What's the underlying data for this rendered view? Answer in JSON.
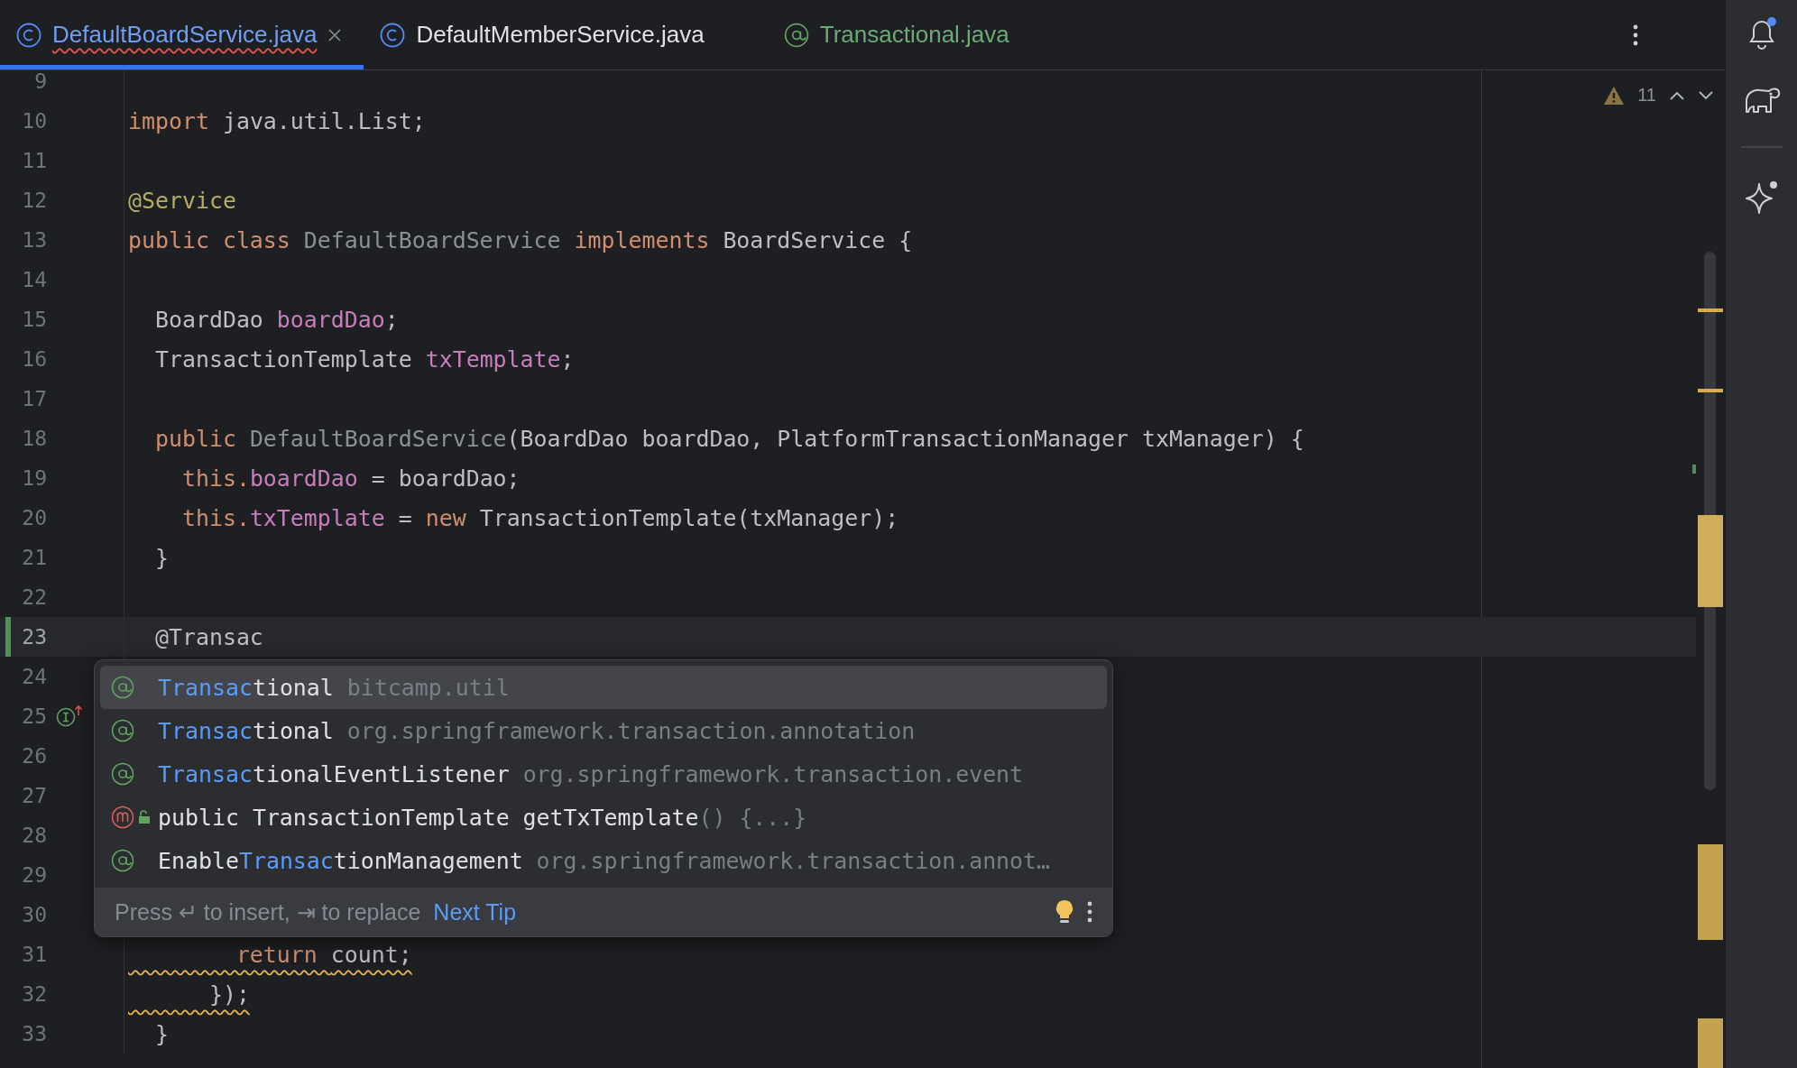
{
  "tabs": [
    {
      "kind": "class",
      "label": "DefaultBoardService.java",
      "color": "#6f9ff5",
      "has_error": true,
      "selected": true
    },
    {
      "kind": "class",
      "label": "DefaultMemberService.java",
      "color": "#dfe1e5",
      "has_error": false,
      "selected": false
    },
    {
      "kind": "annotation",
      "label": "Transactional.java",
      "color": "#6aab73",
      "has_error": false,
      "selected": false
    }
  ],
  "inspections": {
    "warning_count": "11"
  },
  "lines": [
    {
      "number": "9"
    },
    {
      "number": "10",
      "tokens": [
        {
          "text": "import ",
          "kind": "keyword"
        },
        {
          "text": "java.util.List;",
          "kind": "plain"
        }
      ]
    },
    {
      "number": "11"
    },
    {
      "number": "12",
      "tokens": [
        {
          "text": "@Service",
          "kind": "annotation"
        }
      ]
    },
    {
      "number": "13",
      "tokens": [
        {
          "text": "public class ",
          "kind": "keyword"
        },
        {
          "text": "DefaultBoardService ",
          "kind": "unused"
        },
        {
          "text": "implements ",
          "kind": "keyword"
        },
        {
          "text": "BoardService {",
          "kind": "plain"
        }
      ]
    },
    {
      "number": "14"
    },
    {
      "number": "15",
      "tokens": [
        {
          "text": "  BoardDao ",
          "kind": "plain"
        },
        {
          "text": "boardDao",
          "kind": "field"
        },
        {
          "text": ";",
          "kind": "plain"
        }
      ]
    },
    {
      "number": "16",
      "tokens": [
        {
          "text": "  TransactionTemplate ",
          "kind": "plain"
        },
        {
          "text": "txTemplate",
          "kind": "field"
        },
        {
          "text": ";",
          "kind": "plain"
        }
      ]
    },
    {
      "number": "17"
    },
    {
      "number": "18",
      "tokens": [
        {
          "text": "  public ",
          "kind": "keyword"
        },
        {
          "text": "DefaultBoardService",
          "kind": "unused"
        },
        {
          "text": "(BoardDao boardDao, PlatformTransactionManager txManager) {",
          "kind": "plain"
        }
      ]
    },
    {
      "number": "19",
      "tokens": [
        {
          "text": "    this.",
          "kind": "keyword"
        },
        {
          "text": "boardDao",
          "kind": "field"
        },
        {
          "text": " = boardDao;",
          "kind": "plain"
        }
      ]
    },
    {
      "number": "20",
      "tokens": [
        {
          "text": "    this.",
          "kind": "keyword"
        },
        {
          "text": "txTemplate",
          "kind": "field"
        },
        {
          "text": " = ",
          "kind": "plain"
        },
        {
          "text": "new ",
          "kind": "keyword"
        },
        {
          "text": "TransactionTemplate(txManager);",
          "kind": "plain"
        }
      ]
    },
    {
      "number": "21",
      "tokens": [
        {
          "text": "  }",
          "kind": "plain"
        }
      ]
    },
    {
      "number": "22"
    },
    {
      "number": "23",
      "current": true,
      "tokens": [
        {
          "text": "  @Transac",
          "kind": "plain"
        }
      ]
    },
    {
      "number": "24"
    },
    {
      "number": "25",
      "implements_marker": true
    },
    {
      "number": "26"
    },
    {
      "number": "27"
    },
    {
      "number": "28"
    },
    {
      "number": "29"
    },
    {
      "number": "30"
    },
    {
      "number": "31",
      "warning": true,
      "tokens": [
        {
          "text": "        return ",
          "kind": "keyword"
        },
        {
          "text": "count;",
          "kind": "plain"
        }
      ]
    },
    {
      "number": "32",
      "warning": true,
      "tokens": [
        {
          "text": "      });",
          "kind": "plain"
        }
      ]
    },
    {
      "number": "33",
      "tokens": [
        {
          "text": "  }",
          "kind": "plain"
        }
      ]
    }
  ],
  "completion": {
    "items": [
      {
        "kind": "annotation",
        "parts": [
          {
            "text": "Transac",
            "matched": true
          },
          {
            "text": "tional",
            "matched": false
          }
        ],
        "detail": "bitcamp.util",
        "selected": true
      },
      {
        "kind": "annotation",
        "parts": [
          {
            "text": "Transac",
            "matched": true
          },
          {
            "text": "tional",
            "matched": false
          }
        ],
        "detail": "org.springframework.transaction.annotation",
        "selected": false
      },
      {
        "kind": "annotation",
        "parts": [
          {
            "text": "Transac",
            "matched": true
          },
          {
            "text": "tionalEventListener",
            "matched": false
          }
        ],
        "detail": "org.springframework.transaction.event",
        "selected": false
      },
      {
        "kind": "method",
        "parts": [
          {
            "text": "public TransactionTemplate getTxTemplate",
            "matched": false
          }
        ],
        "detail": "() {...}",
        "selected": false
      },
      {
        "kind": "annotation",
        "parts": [
          {
            "text": "Enable",
            "matched": false
          },
          {
            "text": "Transac",
            "matched": true
          },
          {
            "text": "tionManagement",
            "matched": false
          }
        ],
        "detail": "org.springframework.transaction.annot…",
        "selected": false
      }
    ],
    "hint": "Press ↵ to insert, ⇥ to replace",
    "link": "Next Tip"
  }
}
